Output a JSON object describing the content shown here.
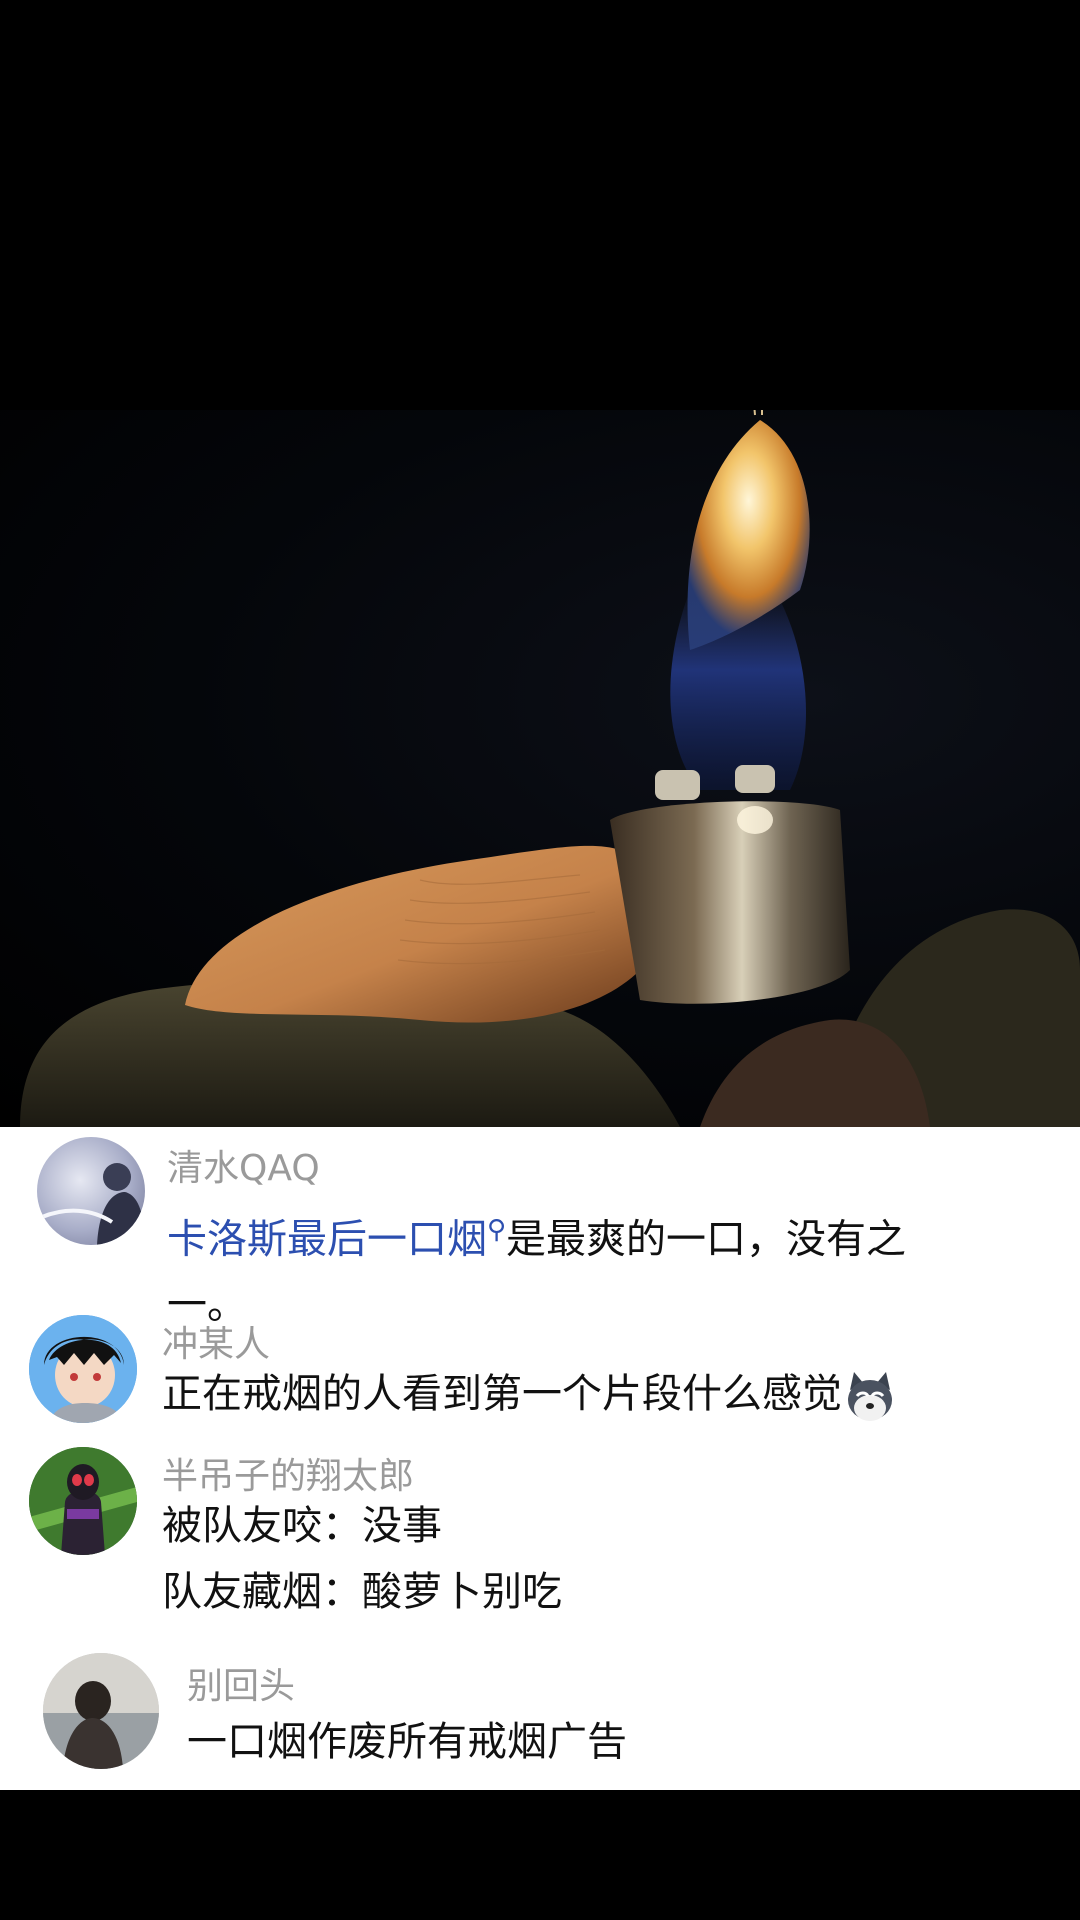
{
  "comments": [
    {
      "user": "清水QAQ",
      "linked_text": "卡洛斯最后一口烟",
      "search_icon": "search-icon",
      "text_line1": "是最爽的一口，没有之",
      "text_line2": "一。"
    },
    {
      "user": "冲某人",
      "text": "正在戒烟的人看到第一个片段什么感觉",
      "emoji": "husky-emoji-icon"
    },
    {
      "user": "半吊子的翔太郎",
      "line1": "被队友咬：没事",
      "line2": "队友藏烟：酸萝卜别吃"
    },
    {
      "user": "别回头",
      "text": "一口烟作废所有戒烟广告"
    }
  ],
  "colors": {
    "link": "#2c4fb0",
    "username": "#9a9a9a",
    "text": "#111111"
  }
}
